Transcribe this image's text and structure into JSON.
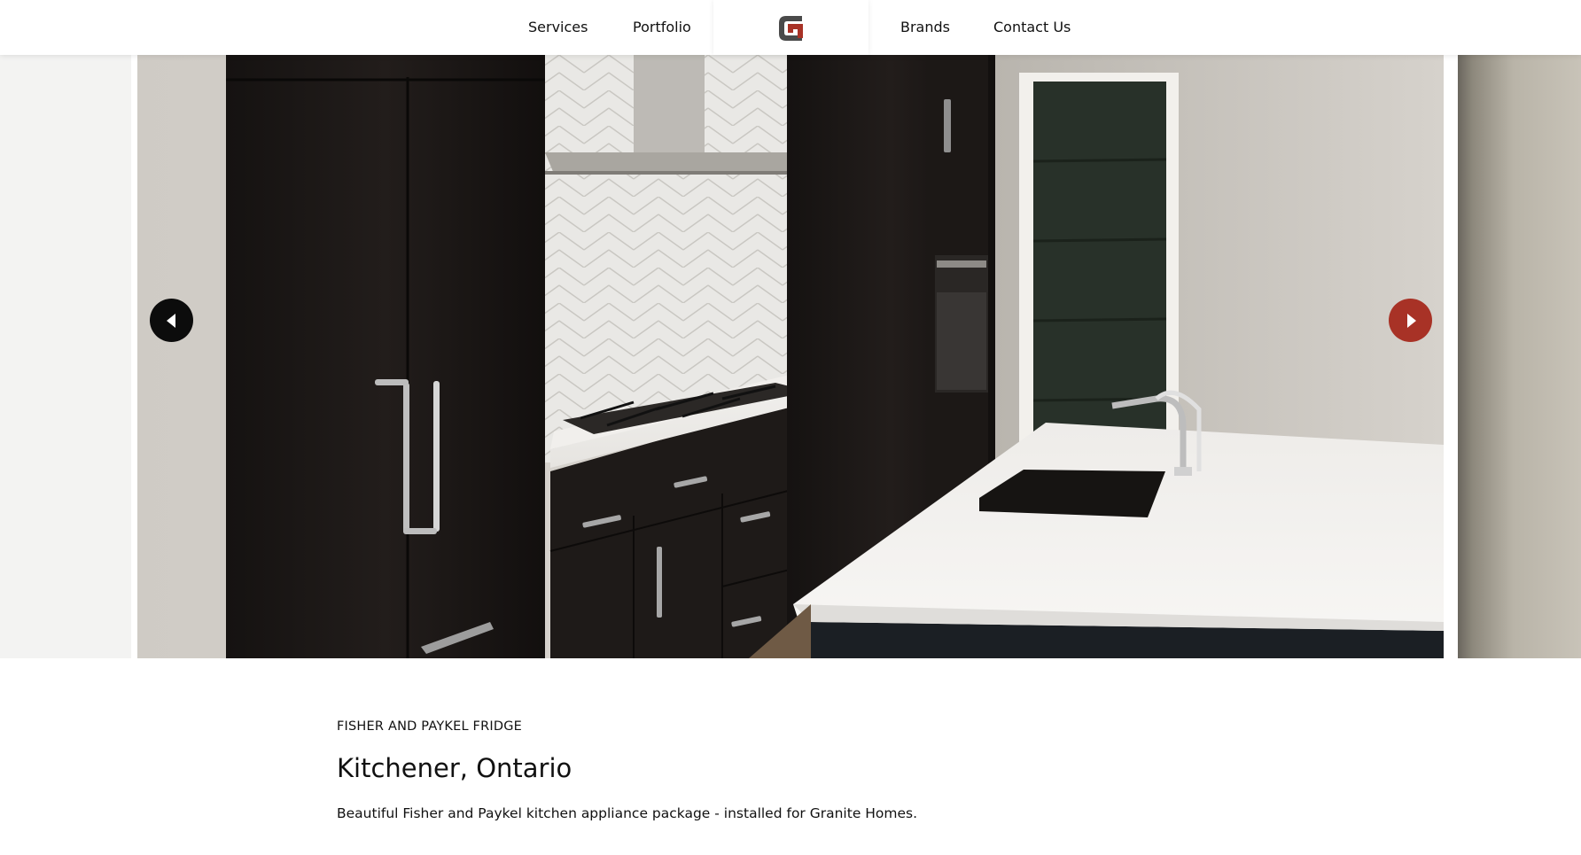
{
  "nav": {
    "items": [
      {
        "label": "Services"
      },
      {
        "label": "Portfolio"
      },
      {
        "label": "Brands"
      },
      {
        "label": "Contact Us"
      }
    ],
    "logo": {
      "icon": "ga-monogram-logo",
      "colors": {
        "outer": "#4a4a4a",
        "inner": "#a83226"
      }
    }
  },
  "carousel": {
    "prev_icon": "caret-left-icon",
    "next_icon": "caret-right-icon",
    "prev_color": "#0c0c0c",
    "next_color": "#a83226",
    "slide_image": "kitchen-photo"
  },
  "caption": {
    "eyebrow": "FISHER AND PAYKEL FRIDGE",
    "title": "Kitchener, Ontario",
    "description": "Beautiful Fisher and Paykel kitchen appliance package - installed for Granite Homes."
  }
}
